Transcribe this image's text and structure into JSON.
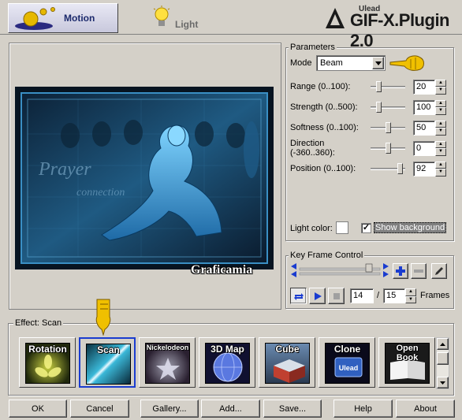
{
  "tabs": [
    {
      "label": "Motion",
      "icon": "motion-icon"
    },
    {
      "label": "Light",
      "icon": "lightbulb-icon"
    }
  ],
  "brand": {
    "small": "Ulead",
    "large": "GIF-X.Plugin 2.0"
  },
  "preview": {
    "watermark": "Graficamia",
    "art_text_1": "Prayer",
    "art_text_2": "connection"
  },
  "parameters": {
    "title": "Parameters",
    "mode_label": "Mode",
    "mode_value": "Beam",
    "rows": [
      {
        "label": "Range (0..100):",
        "value": "20",
        "level": 0.2
      },
      {
        "label": "Strength (0..500):",
        "value": "100",
        "level": 0.2
      },
      {
        "label": "Softness (0..100):",
        "value": "50",
        "level": 0.5
      },
      {
        "label": "Direction (-360..360):",
        "value": "0",
        "level": 0.5
      },
      {
        "label": "Position (0..100):",
        "value": "92",
        "level": 0.92
      }
    ],
    "light_color_label": "Light color:",
    "show_background_label": "Show background",
    "show_background_checked": true
  },
  "keyframe": {
    "title": "Key Frame Control",
    "current_frame": "14",
    "total_frames": "15",
    "frames_label": "Frames",
    "separator": "/"
  },
  "effects": {
    "title": "Effect: Scan",
    "items": [
      {
        "label": "Rotation",
        "selected": false
      },
      {
        "label": "Scan",
        "selected": true
      },
      {
        "label": "Nickelodeon",
        "selected": false
      },
      {
        "label": "3D Map",
        "selected": false
      },
      {
        "label": "Cube",
        "selected": false
      },
      {
        "label": "Clone",
        "selected": false
      },
      {
        "label": "Open Book",
        "selected": false
      }
    ],
    "clone_logo": "Ulead"
  },
  "buttons": {
    "ok": "OK",
    "cancel": "Cancel",
    "gallery": "Gallery...",
    "add": "Add...",
    "save": "Save...",
    "help": "Help",
    "about": "About"
  },
  "colors": {
    "accent": "#1a3cd0",
    "hand_pointer": "#f0c000",
    "art_blue": "#2e7fb8"
  }
}
